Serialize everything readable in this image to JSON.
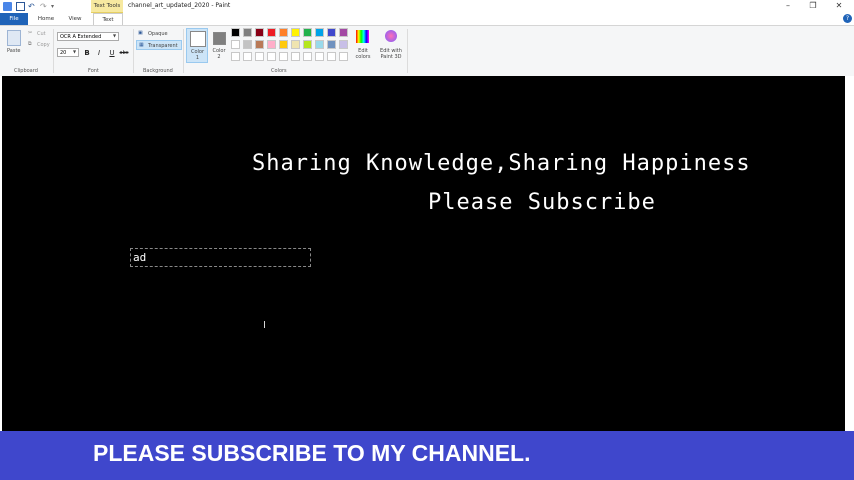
{
  "titlebar": {
    "title": "channel_art_updated_2020 - Paint",
    "context_tab": "Text Tools",
    "quick_access_icons": [
      "paint-app-icon",
      "save-icon",
      "undo-icon",
      "redo-icon",
      "customize-icon"
    ],
    "window_buttons": [
      "minimize-icon",
      "restore-icon",
      "close-icon"
    ]
  },
  "tabs": [
    "File",
    "Home",
    "View",
    "Text"
  ],
  "ribbon": {
    "clipboard": {
      "paste": "Paste",
      "cut": "Cut",
      "copy": "Copy",
      "label": "Clipboard"
    },
    "font": {
      "family": "OCR A Extended",
      "size": "20",
      "bold": "B",
      "italic": "I",
      "underline": "U",
      "strike": "abc",
      "label": "Font"
    },
    "background": {
      "opaque": "Opaque",
      "transparent": "Transparent",
      "label": "Background"
    },
    "colors": {
      "color1": "Color 1",
      "color2": "Color 2",
      "edit": "Edit colors",
      "paint3d": "Edit with Paint 3D",
      "label": "Colors",
      "color1_value": "#ffffff",
      "color2_value": "#7f7f7f",
      "palette_row1": [
        "#000000",
        "#7f7f7f",
        "#880015",
        "#ed1c24",
        "#ff7f27",
        "#fff200",
        "#22b14c",
        "#00a2e8",
        "#3f48cc",
        "#a349a4"
      ],
      "palette_row2": [
        "#ffffff",
        "#c3c3c3",
        "#b97a57",
        "#ffaec9",
        "#ffc90e",
        "#efe4b0",
        "#b5e61d",
        "#99d9ea",
        "#7092be",
        "#c8bfe7"
      ],
      "palette_row3": [
        "#ffffff",
        "#ffffff",
        "#ffffff",
        "#ffffff",
        "#ffffff",
        "#ffffff",
        "#ffffff",
        "#ffffff",
        "#ffffff",
        "#ffffff"
      ]
    }
  },
  "canvas": {
    "line1": "Sharing Knowledge,Sharing Happiness",
    "line2": "Please Subscribe",
    "textbox_value": "ad"
  },
  "banner": {
    "text": "PLEASE SUBSCRIBE TO MY CHANNEL."
  }
}
